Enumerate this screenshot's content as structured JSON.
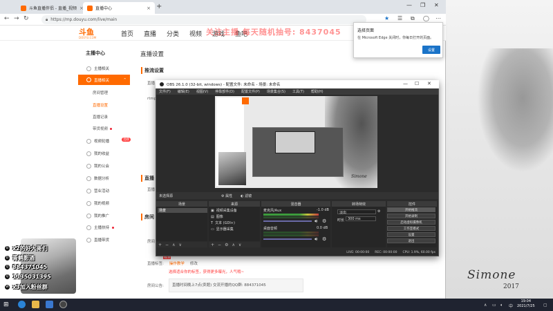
{
  "browser": {
    "tabs": [
      {
        "label": "斗鱼直播伴侣 - 直播_视频"
      },
      {
        "label": "直播中心"
      }
    ],
    "url": "https://mp.douyu.com/live/main"
  },
  "header": {
    "logo": "斗鱼",
    "logo_sub": "DOUYU.COM",
    "nav": [
      "首页",
      "直播",
      "分类",
      "视频",
      "游戏",
      "鱼吧"
    ],
    "overlay": "关注主播 每天随机抽号: 8437045"
  },
  "sidebar": {
    "title": "主播中心",
    "items": [
      {
        "label": "主播相关"
      },
      {
        "label": "直播相关"
      },
      {
        "label": "房间管理"
      },
      {
        "label": "直播设置"
      },
      {
        "label": "直播记录"
      },
      {
        "label": "带货视频"
      },
      {
        "label": "视频轮播"
      },
      {
        "label": "我的收益"
      },
      {
        "label": "我的公会"
      },
      {
        "label": "数据分析"
      },
      {
        "label": "营业活动"
      },
      {
        "label": "我的视频"
      },
      {
        "label": "我的推广"
      },
      {
        "label": "主播扶持"
      },
      {
        "label": "直播带货"
      }
    ],
    "badge": "活跃"
  },
  "main": {
    "title": "直播设置",
    "section_push": "推流设置",
    "label_rtmp": "rtmp",
    "label_addr": "直播",
    "section_room": "直播",
    "label_room": "直播",
    "section_house": "房间",
    "label_room2": "房间",
    "tag_label": "直播标签:",
    "tag_link": "操作教学",
    "tag_edit": "修改",
    "tag_new": "NEW",
    "tag_hint": "选择适合你的标签，获得更多曝光，人气哦~",
    "notice_label": "房间公告:",
    "notice_text": "直播时间晚上7点(卖题) 交流开播的QQ群: 884371045"
  },
  "popup": {
    "title": "选择页面",
    "message": "在 Microsoft Edge 关闭时，你每日打开的页面。",
    "button": "设置"
  },
  "obs": {
    "title": "OBS 26.1.0 (32-bit, windows) - 配置文件: 未命名 - 场景: 未命名",
    "menu": [
      "文件(F)",
      "编辑(E)",
      "视图(V)",
      "停靠部件(D)",
      "配置文件(P)",
      "场景集合(S)",
      "工具(T)",
      "帮助(H)"
    ],
    "scene_label": "未选择源",
    "scene_props": "属性",
    "scene_filters": "滤镜",
    "docks": {
      "scenes": "场景",
      "sources": "来源",
      "mixer": "混音器",
      "transitions": "转场特效",
      "controls": "控件"
    },
    "scene_items": [
      "场景"
    ],
    "source_items": [
      "视频采集设备",
      "图像",
      "文本 (GDI+)",
      "显示器采集"
    ],
    "mixer": [
      {
        "name": "麦克风/Aux",
        "db": "-1.0 dB"
      },
      {
        "name": "桌面音频",
        "db": "0.0 dB"
      }
    ],
    "transition": "淡出",
    "duration_label": "时长",
    "duration": "300 ms",
    "controls": [
      "开始推流",
      "开始录制",
      "启动虚拟摄像机",
      "工作室模式",
      "设置",
      "退出"
    ],
    "status": [
      "LIVE: 00:00:00",
      "REC: 00:00:00",
      "CPU: 1.9%, 60.00 fps"
    ]
  },
  "stream_overlay": {
    "rows": [
      {
        "icon": "B",
        "text": "x2的好大哥们"
      },
      {
        "icon": "D",
        "text": "青鹤影酒"
      },
      {
        "icon": "Q",
        "text": "884371045"
      },
      {
        "icon": "Q",
        "text": "1135031395"
      },
      {
        "icon": "W",
        "text": "x3加入粉丝群"
      }
    ]
  },
  "wallpaper": {
    "sign": "Simone",
    "year": "2017"
  },
  "taskbar": {
    "time": "19:04",
    "date": "2021/7/25"
  }
}
